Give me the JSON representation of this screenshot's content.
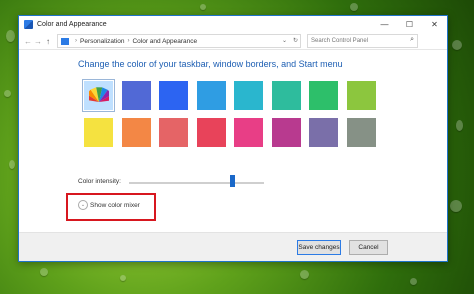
{
  "window": {
    "title": "Color and Appearance"
  },
  "window_controls": {
    "minimize": "—",
    "maximize": "☐",
    "close": "✕"
  },
  "address": {
    "back": "←",
    "forward": "→",
    "up": "↑",
    "crumbs": [
      "Personalization",
      "Color and Appearance"
    ],
    "dropdown": "⌄",
    "refresh": "↻",
    "search_placeholder": "Search Control Panel"
  },
  "main": {
    "heading": "Change the color of your taskbar, window borders, and Start menu",
    "swatches": [
      {
        "color": "#bfe0ff",
        "icon": "color-fan-icon",
        "selected": true
      },
      {
        "color": "#5169d6"
      },
      {
        "color": "#2c64f2"
      },
      {
        "color": "#2f9de3"
      },
      {
        "color": "#2ab6ce"
      },
      {
        "color": "#2ebc9d"
      },
      {
        "color": "#2dbf6a"
      },
      {
        "color": "#8cc63e"
      },
      {
        "color": "#f5e240"
      },
      {
        "color": "#f38745"
      },
      {
        "color": "#e56466"
      },
      {
        "color": "#e8435a"
      },
      {
        "color": "#e83e86"
      },
      {
        "color": "#b83a8f"
      },
      {
        "color": "#7a6fa9"
      },
      {
        "color": "#869186"
      }
    ],
    "intensity_label": "Color intensity:",
    "intensity_value": 0.77,
    "mixer_label": "Show color mixer",
    "mixer_icon": "chevron-down-icon"
  },
  "footer": {
    "save_label": "Save changes",
    "cancel_label": "Cancel"
  },
  "colors": {
    "accent": "#1a68c9",
    "highlight_box": "#d7171f",
    "heading": "#1e5fb3"
  }
}
